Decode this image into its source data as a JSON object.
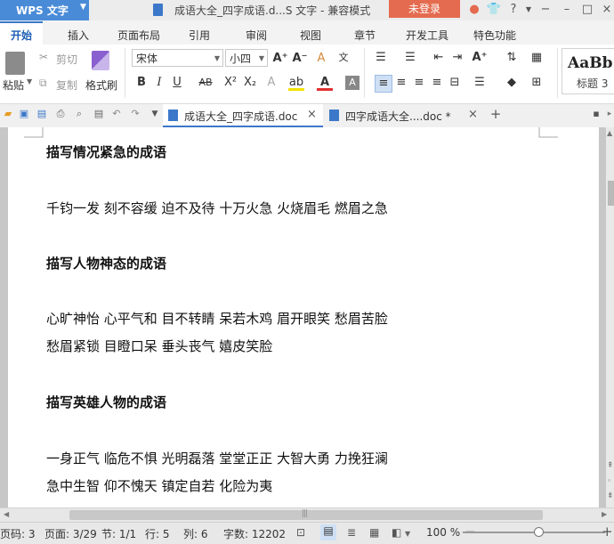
{
  "app": {
    "menu_label": "WPS 文字",
    "doc_title": "成语大全_四字成语.d...S 文字 - 兼容模式",
    "login_label": "未登录"
  },
  "ribbon_tabs": [
    "开始",
    "插入",
    "页面布局",
    "引用",
    "审阅",
    "视图",
    "章节",
    "开发工具",
    "特色功能"
  ],
  "toolbar": {
    "paste": "粘贴",
    "cut": "剪切",
    "copy": "复制",
    "format_painter": "格式刷",
    "font_name": "宋体",
    "font_size": "小四",
    "style_sample": "AaBb",
    "style_name": "标题 3"
  },
  "doc_tabs": [
    {
      "title": "成语大全_四字成语.doc",
      "active": true
    },
    {
      "title": "四字成语大全....doc *",
      "active": false
    }
  ],
  "document": {
    "lines": [
      {
        "text": "描写情况紧急的成语",
        "heading": true
      },
      {
        "text": "千钧一发 刻不容缓 迫不及待 十万火急 火烧眉毛 燃眉之急",
        "heading": false
      },
      {
        "text": "描写人物神态的成语",
        "heading": true
      },
      {
        "text": "心旷神怡 心平气和 目不转睛 呆若木鸡 眉开眼笑 愁眉苦脸",
        "heading": false
      },
      {
        "text": "愁眉紧锁 目瞪口呆 垂头丧气 嬉皮笑脸",
        "heading": false
      },
      {
        "text": "描写英雄人物的成语",
        "heading": true
      },
      {
        "text": "一身正气 临危不惧 光明磊落 堂堂正正 大智大勇 力挽狂澜",
        "heading": false
      },
      {
        "text": "急中生智 仰不愧天 镇定自若 化险为夷",
        "heading": false
      }
    ]
  },
  "status": {
    "page_code": "页码: 3",
    "page": "页面: 3/29",
    "section": "节: 1/1",
    "row": "行: 5",
    "col": "列: 6",
    "word_count": "字数: 12202",
    "zoom": "100 %",
    "zoom_level_percent": 100
  },
  "colors": {
    "accent": "#3c78c9",
    "login": "#e46b4f",
    "wps_button": "#4a8bd8"
  }
}
